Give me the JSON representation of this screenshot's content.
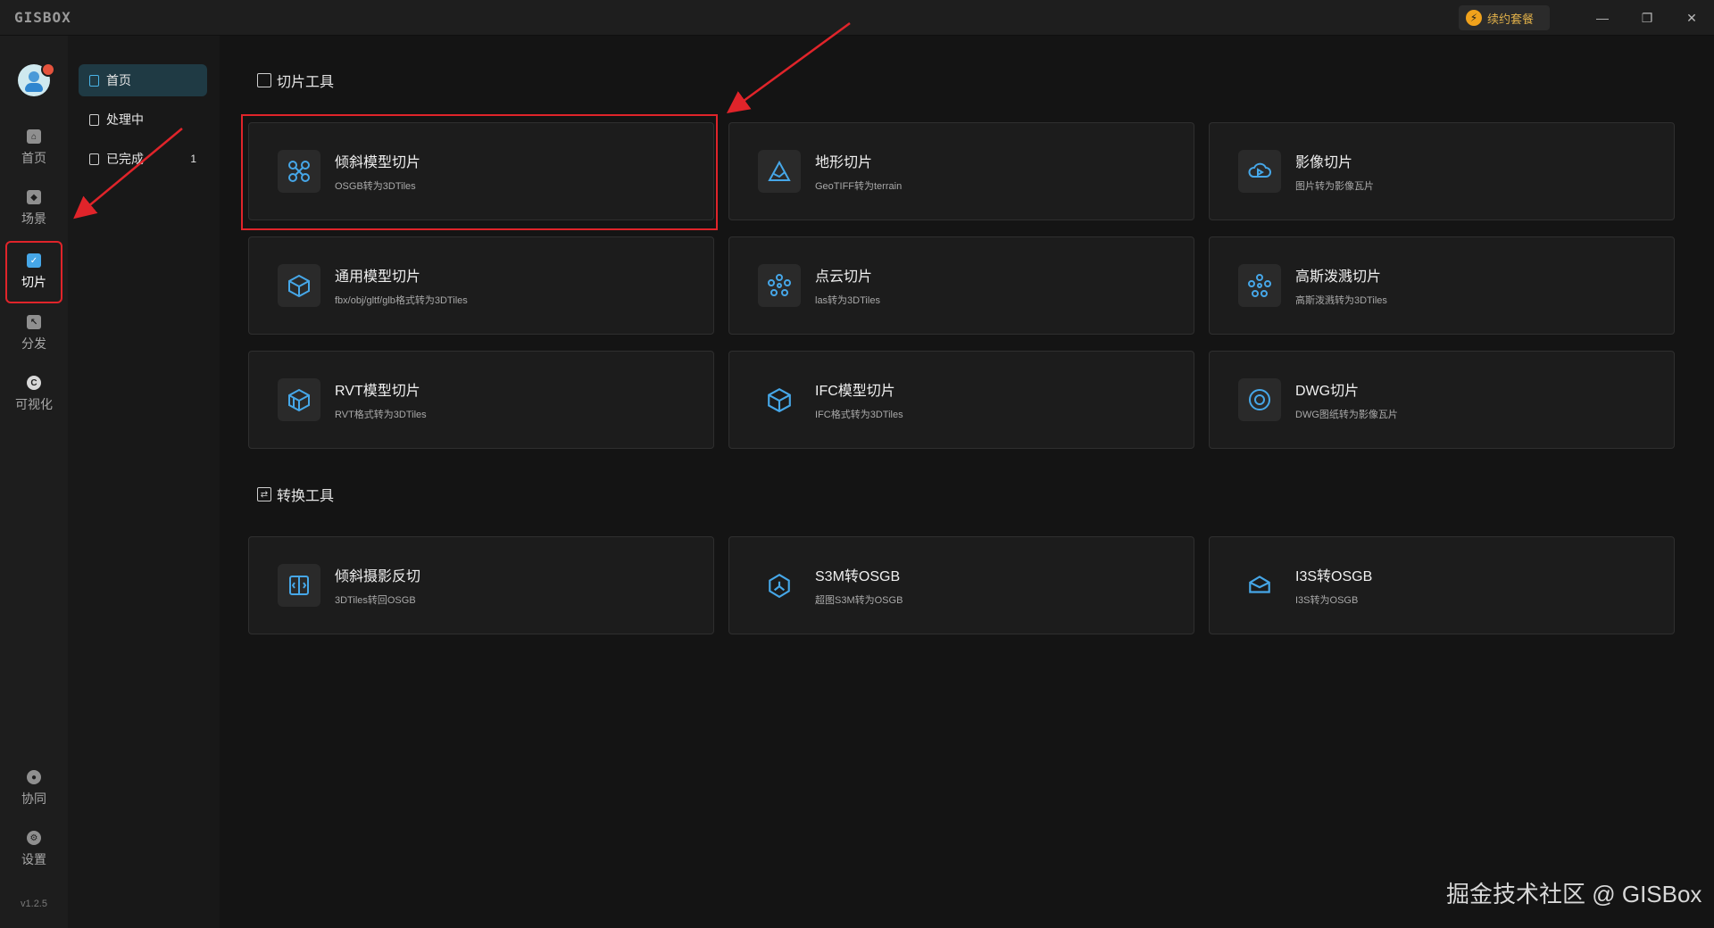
{
  "titlebar": {
    "app_name": "GISBOX",
    "renew_label": "续约套餐",
    "renew_icon": "bolt-icon",
    "minimize": "—",
    "restore": "❐",
    "close": "✕"
  },
  "rail": {
    "items": [
      {
        "label": "首页",
        "icon": "home-icon"
      },
      {
        "label": "场景",
        "icon": "cube-icon"
      },
      {
        "label": "切片",
        "icon": "slice-icon"
      },
      {
        "label": "分发",
        "icon": "share-icon"
      },
      {
        "label": "可视化",
        "icon": "chart-icon"
      },
      {
        "label": "协同",
        "icon": "team-icon"
      },
      {
        "label": "设置",
        "icon": "gear-icon"
      }
    ],
    "version": "v1.2.5"
  },
  "subnav": {
    "items": [
      {
        "label": "首页",
        "badge": ""
      },
      {
        "label": "处理中",
        "badge": ""
      },
      {
        "label": "已完成",
        "badge": "1"
      }
    ]
  },
  "sections": {
    "slice_tools": {
      "title": "切片工具",
      "cards": [
        {
          "title": "倾斜模型切片",
          "subtitle": "OSGB转为3DTiles",
          "icon": "drone-icon"
        },
        {
          "title": "地形切片",
          "subtitle": "GeoTIFF转为terrain",
          "icon": "terrain-icon"
        },
        {
          "title": "影像切片",
          "subtitle": "图片转为影像瓦片",
          "icon": "cloud-image-icon"
        },
        {
          "title": "通用模型切片",
          "subtitle": "fbx/obj/gltf/glb格式转为3DTiles",
          "icon": "box-icon"
        },
        {
          "title": "点云切片",
          "subtitle": "las转为3DTiles",
          "icon": "point-cloud-icon"
        },
        {
          "title": "高斯泼溅切片",
          "subtitle": "高斯泼溅转为3DTiles",
          "icon": "gaussian-icon"
        },
        {
          "title": "RVT模型切片",
          "subtitle": "RVT格式转为3DTiles",
          "icon": "rvt-icon"
        },
        {
          "title": "IFC模型切片",
          "subtitle": "IFC格式转为3DTiles",
          "icon": "ifc-icon"
        },
        {
          "title": "DWG切片",
          "subtitle": "DWG图纸转为影像瓦片",
          "icon": "dwg-icon"
        }
      ]
    },
    "convert_tools": {
      "title": "转换工具",
      "cards": [
        {
          "title": "倾斜摄影反切",
          "subtitle": "3DTiles转回OSGB",
          "icon": "reverse-icon"
        },
        {
          "title": "S3M转OSGB",
          "subtitle": "超图S3M转为OSGB",
          "icon": "s3m-icon"
        },
        {
          "title": "I3S转OSGB",
          "subtitle": "I3S转为OSGB",
          "icon": "i3s-icon"
        }
      ]
    }
  },
  "accent_color": "#46a7e8",
  "highlight_color": "#e0242a",
  "watermark": "掘金技术社区 @ GISBox"
}
